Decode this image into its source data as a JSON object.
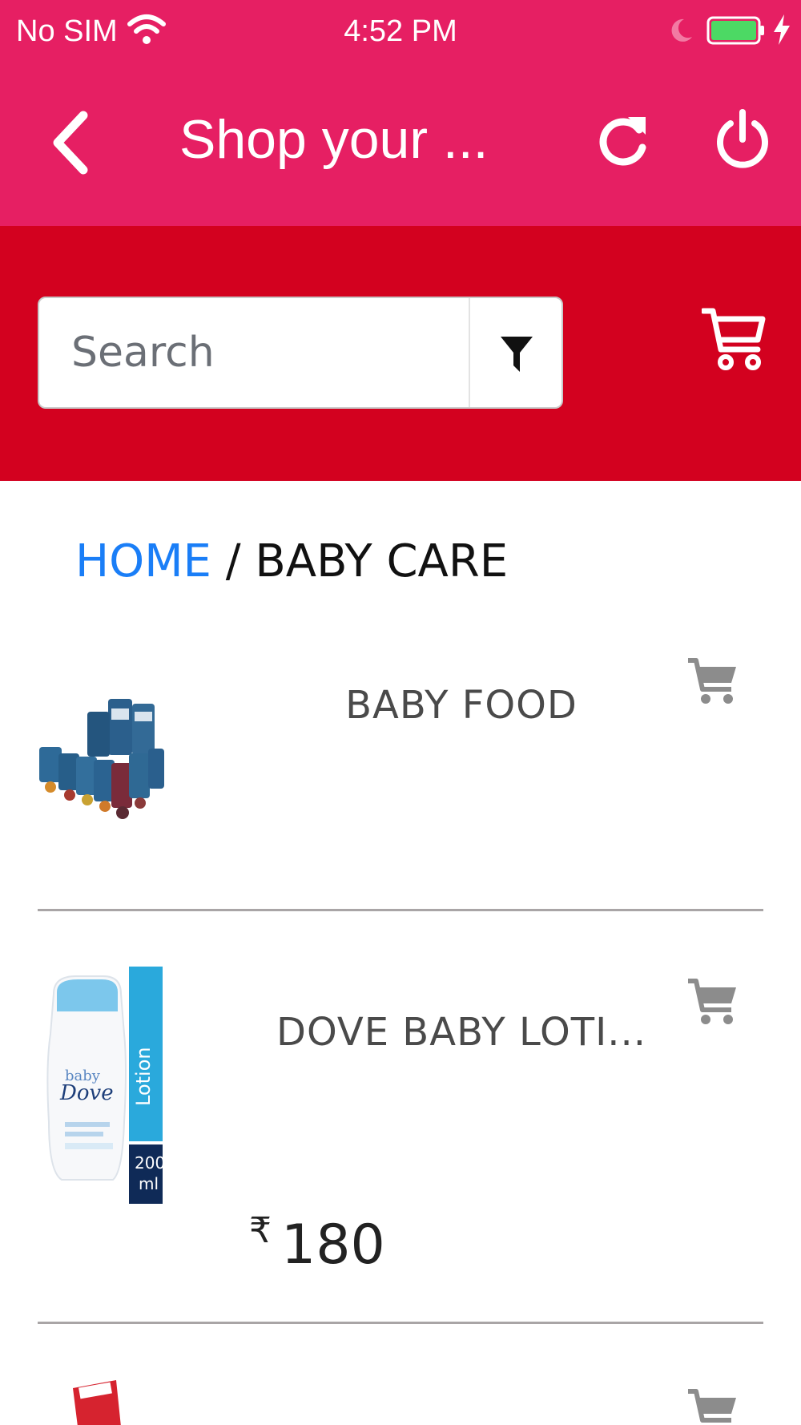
{
  "status_bar": {
    "carrier": "No SIM",
    "time": "4:52 PM",
    "battery_level": 1.0
  },
  "header": {
    "title": "Shop your ..."
  },
  "search": {
    "placeholder": "Search"
  },
  "breadcrumb": {
    "home": "HOME",
    "separator": " / ",
    "current": "BABY CARE"
  },
  "products": [
    {
      "name": "BABY FOOD",
      "icon": "baby-food-thumbnail"
    },
    {
      "name": "DOVE BABY LOTI...",
      "currency": "₹",
      "price": "180",
      "icon": "dove-baby-lotion-thumbnail"
    },
    {
      "name": "",
      "icon": "colgate-thumbnail"
    }
  ],
  "colors": {
    "header_pink": "#e61f63",
    "search_band_red": "#d3011f",
    "link_blue": "#1a7ef7",
    "cart_gray": "#8c8c8c"
  }
}
